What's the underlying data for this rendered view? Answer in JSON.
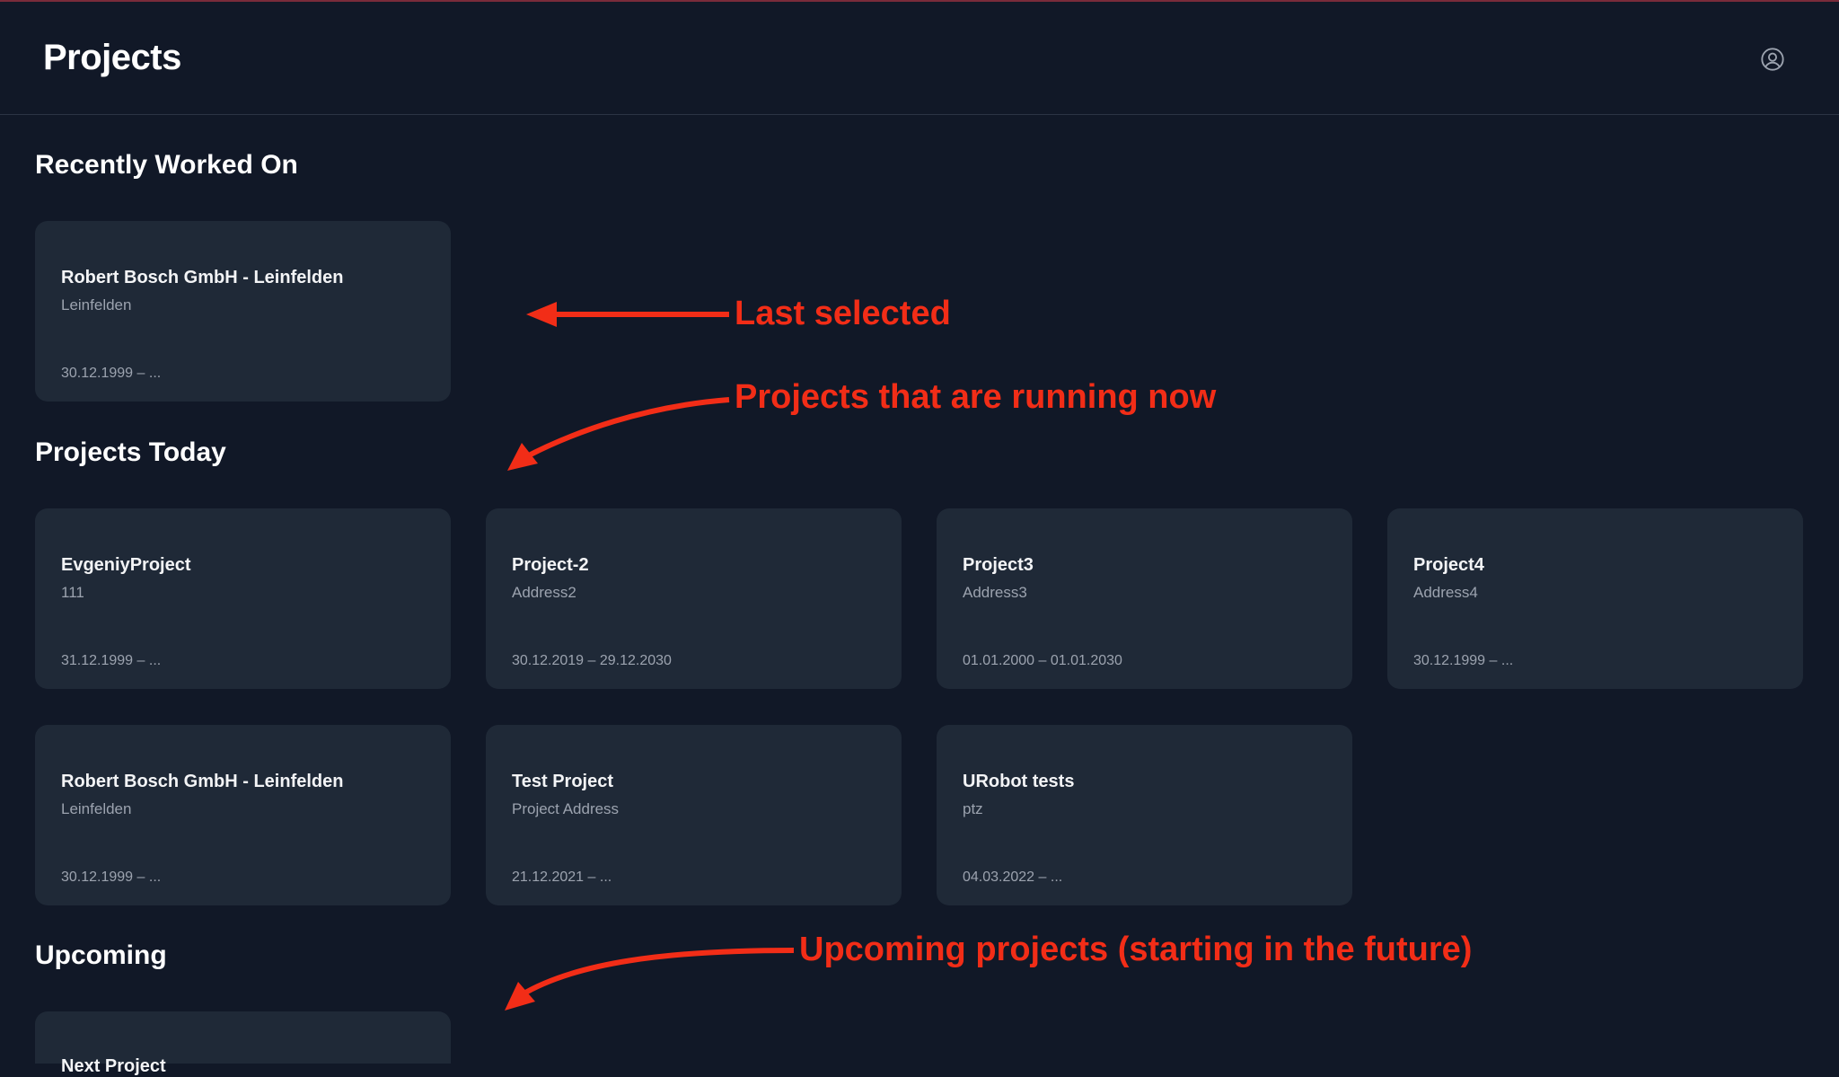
{
  "header": {
    "title": "Projects",
    "profile_icon": "user-circle-icon"
  },
  "sections": {
    "recent": {
      "title": "Recently Worked On",
      "cards": [
        {
          "name": "Robert Bosch GmbH - Leinfelden",
          "address": "Leinfelden",
          "dates": "30.12.1999 – ..."
        }
      ]
    },
    "today": {
      "title": "Projects Today",
      "cards": [
        {
          "name": "EvgeniyProject",
          "address": "111",
          "dates": "31.12.1999 – ..."
        },
        {
          "name": "Project-2",
          "address": "Address2",
          "dates": "30.12.2019 – 29.12.2030"
        },
        {
          "name": "Project3",
          "address": "Address3",
          "dates": "01.01.2000 – 01.01.2030"
        },
        {
          "name": "Project4",
          "address": "Address4",
          "dates": "30.12.1999 – ..."
        },
        {
          "name": "Robert Bosch GmbH - Leinfelden",
          "address": "Leinfelden",
          "dates": "30.12.1999 – ..."
        },
        {
          "name": "Test Project",
          "address": "Project Address",
          "dates": "21.12.2021 – ..."
        },
        {
          "name": "URobot tests",
          "address": "ptz",
          "dates": "04.03.2022 – ..."
        }
      ]
    },
    "upcoming": {
      "title": "Upcoming",
      "cards": [
        {
          "name": "Next Project",
          "address": "",
          "dates": ""
        }
      ]
    }
  },
  "annotations": {
    "last_selected": "Last selected",
    "running_now": "Projects that are running now",
    "upcoming": "Upcoming projects (starting in the future)"
  },
  "colors": {
    "background": "#111827",
    "card": "#1f2937",
    "annotation": "#f22d17",
    "muted_text": "#9ca3af"
  }
}
